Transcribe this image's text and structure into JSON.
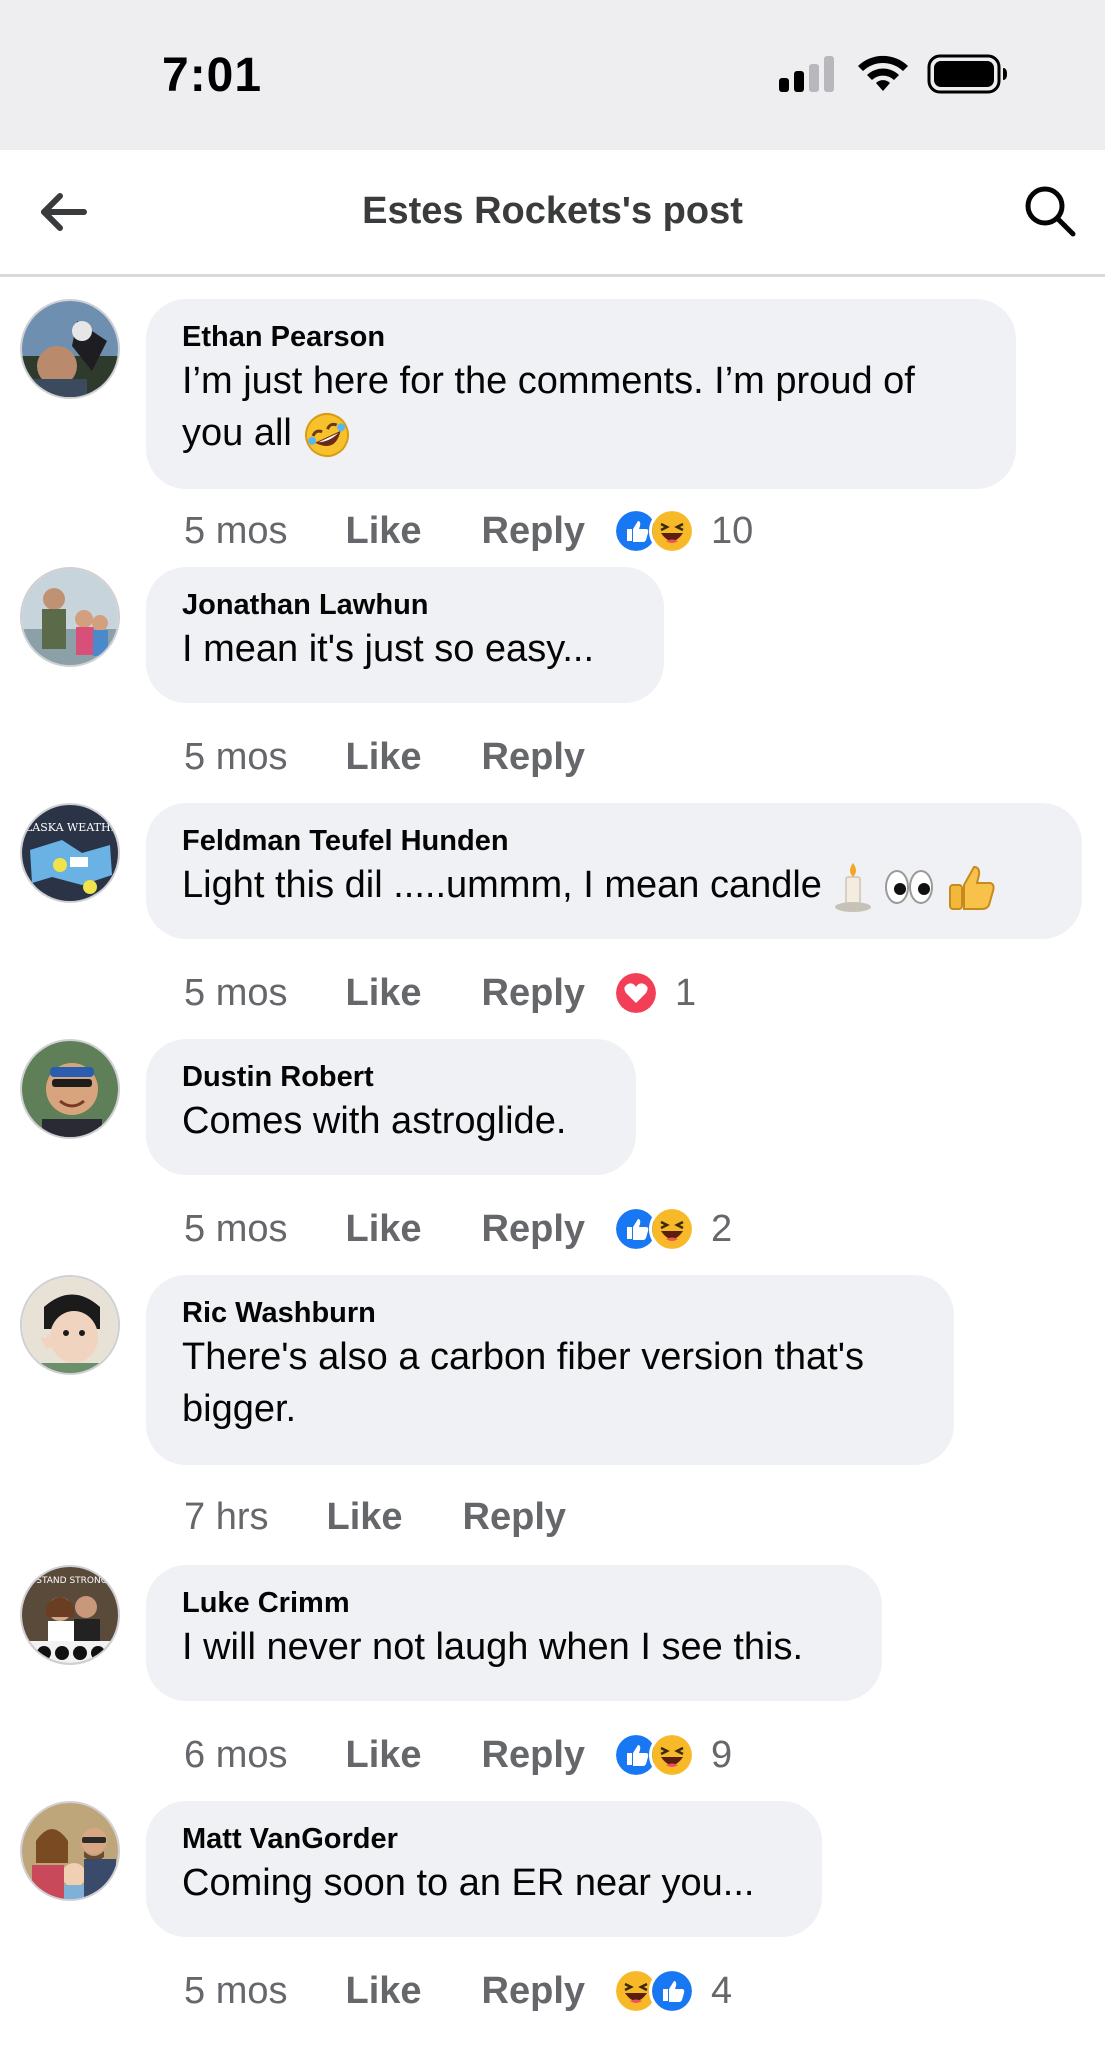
{
  "status_bar": {
    "time": "7:01",
    "icons": [
      "cellular-signal-icon",
      "wifi-icon",
      "battery-icon"
    ]
  },
  "header": {
    "title": "Estes Rockets's post",
    "back_icon": "back-arrow-icon",
    "search_icon": "search-icon"
  },
  "colors": {
    "bubble": "#f0f1f4",
    "meta_text": "#65676b",
    "like_blue": "#1877f2",
    "haha_yellow": "#f7b928",
    "love_red": "#f33e58"
  },
  "comments": [
    {
      "author": "Ethan Pearson",
      "text": "I’m just here for the comments. I’m proud of you all",
      "text_emoji": "rolling-on-floor-laughing-emoji",
      "time": "5 mos",
      "like_label": "Like",
      "reply_label": "Reply",
      "reactions": [
        "like",
        "haha"
      ],
      "reaction_count": "10"
    },
    {
      "author": "Jonathan Lawhun",
      "text": "I mean it's just so easy...",
      "time": "5 mos",
      "like_label": "Like",
      "reply_label": "Reply",
      "reactions": [],
      "reaction_count": ""
    },
    {
      "author": "Feldman Teufel Hunden",
      "text": "Light this dil .....ummm, I mean candle",
      "text_emoji": "candle-eyes-thumbs-up-emoji",
      "avatar_text": "ALASKA WEATHER",
      "time": "5 mos",
      "like_label": "Like",
      "reply_label": "Reply",
      "reactions": [
        "love"
      ],
      "reaction_count": "1"
    },
    {
      "author": "Dustin Robert",
      "text": "Comes with astroglide.",
      "time": "5 mos",
      "like_label": "Like",
      "reply_label": "Reply",
      "reactions": [
        "like",
        "haha"
      ],
      "reaction_count": "2"
    },
    {
      "author": "Ric Washburn",
      "text": "There's also a carbon fiber version that's bigger.",
      "time": "7 hrs",
      "like_label": "Like",
      "reply_label": "Reply",
      "reactions": [],
      "reaction_count": ""
    },
    {
      "author": "Luke Crimm",
      "text": "I will never not laugh when I see this.",
      "avatar_text": "STAND STRONG",
      "time": "6 mos",
      "like_label": "Like",
      "reply_label": "Reply",
      "reactions": [
        "like",
        "haha"
      ],
      "reaction_count": "9"
    },
    {
      "author": "Matt VanGorder",
      "text": "Coming soon to an ER near you...",
      "time": "5 mos",
      "like_label": "Like",
      "reply_label": "Reply",
      "reactions": [
        "haha",
        "like"
      ],
      "reaction_count": "4"
    }
  ]
}
